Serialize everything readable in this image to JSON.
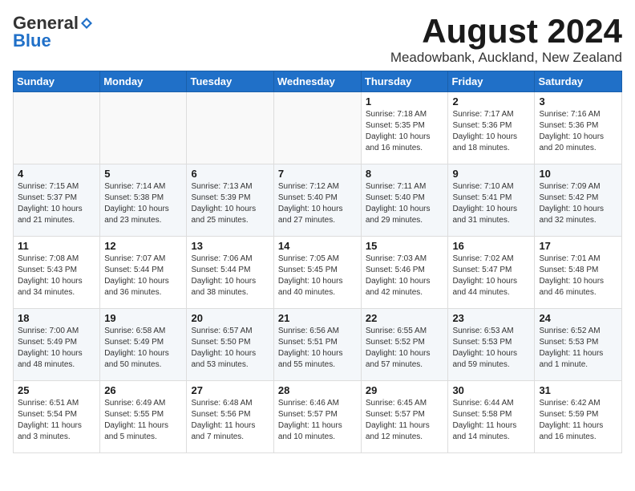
{
  "header": {
    "logo_general": "General",
    "logo_blue": "Blue",
    "month_title": "August 2024",
    "location": "Meadowbank, Auckland, New Zealand"
  },
  "weekdays": [
    "Sunday",
    "Monday",
    "Tuesday",
    "Wednesday",
    "Thursday",
    "Friday",
    "Saturday"
  ],
  "weeks": [
    [
      {
        "day": "",
        "info": ""
      },
      {
        "day": "",
        "info": ""
      },
      {
        "day": "",
        "info": ""
      },
      {
        "day": "",
        "info": ""
      },
      {
        "day": "1",
        "info": "Sunrise: 7:18 AM\nSunset: 5:35 PM\nDaylight: 10 hours\nand 16 minutes."
      },
      {
        "day": "2",
        "info": "Sunrise: 7:17 AM\nSunset: 5:36 PM\nDaylight: 10 hours\nand 18 minutes."
      },
      {
        "day": "3",
        "info": "Sunrise: 7:16 AM\nSunset: 5:36 PM\nDaylight: 10 hours\nand 20 minutes."
      }
    ],
    [
      {
        "day": "4",
        "info": "Sunrise: 7:15 AM\nSunset: 5:37 PM\nDaylight: 10 hours\nand 21 minutes."
      },
      {
        "day": "5",
        "info": "Sunrise: 7:14 AM\nSunset: 5:38 PM\nDaylight: 10 hours\nand 23 minutes."
      },
      {
        "day": "6",
        "info": "Sunrise: 7:13 AM\nSunset: 5:39 PM\nDaylight: 10 hours\nand 25 minutes."
      },
      {
        "day": "7",
        "info": "Sunrise: 7:12 AM\nSunset: 5:40 PM\nDaylight: 10 hours\nand 27 minutes."
      },
      {
        "day": "8",
        "info": "Sunrise: 7:11 AM\nSunset: 5:40 PM\nDaylight: 10 hours\nand 29 minutes."
      },
      {
        "day": "9",
        "info": "Sunrise: 7:10 AM\nSunset: 5:41 PM\nDaylight: 10 hours\nand 31 minutes."
      },
      {
        "day": "10",
        "info": "Sunrise: 7:09 AM\nSunset: 5:42 PM\nDaylight: 10 hours\nand 32 minutes."
      }
    ],
    [
      {
        "day": "11",
        "info": "Sunrise: 7:08 AM\nSunset: 5:43 PM\nDaylight: 10 hours\nand 34 minutes."
      },
      {
        "day": "12",
        "info": "Sunrise: 7:07 AM\nSunset: 5:44 PM\nDaylight: 10 hours\nand 36 minutes."
      },
      {
        "day": "13",
        "info": "Sunrise: 7:06 AM\nSunset: 5:44 PM\nDaylight: 10 hours\nand 38 minutes."
      },
      {
        "day": "14",
        "info": "Sunrise: 7:05 AM\nSunset: 5:45 PM\nDaylight: 10 hours\nand 40 minutes."
      },
      {
        "day": "15",
        "info": "Sunrise: 7:03 AM\nSunset: 5:46 PM\nDaylight: 10 hours\nand 42 minutes."
      },
      {
        "day": "16",
        "info": "Sunrise: 7:02 AM\nSunset: 5:47 PM\nDaylight: 10 hours\nand 44 minutes."
      },
      {
        "day": "17",
        "info": "Sunrise: 7:01 AM\nSunset: 5:48 PM\nDaylight: 10 hours\nand 46 minutes."
      }
    ],
    [
      {
        "day": "18",
        "info": "Sunrise: 7:00 AM\nSunset: 5:49 PM\nDaylight: 10 hours\nand 48 minutes."
      },
      {
        "day": "19",
        "info": "Sunrise: 6:58 AM\nSunset: 5:49 PM\nDaylight: 10 hours\nand 50 minutes."
      },
      {
        "day": "20",
        "info": "Sunrise: 6:57 AM\nSunset: 5:50 PM\nDaylight: 10 hours\nand 53 minutes."
      },
      {
        "day": "21",
        "info": "Sunrise: 6:56 AM\nSunset: 5:51 PM\nDaylight: 10 hours\nand 55 minutes."
      },
      {
        "day": "22",
        "info": "Sunrise: 6:55 AM\nSunset: 5:52 PM\nDaylight: 10 hours\nand 57 minutes."
      },
      {
        "day": "23",
        "info": "Sunrise: 6:53 AM\nSunset: 5:53 PM\nDaylight: 10 hours\nand 59 minutes."
      },
      {
        "day": "24",
        "info": "Sunrise: 6:52 AM\nSunset: 5:53 PM\nDaylight: 11 hours\nand 1 minute."
      }
    ],
    [
      {
        "day": "25",
        "info": "Sunrise: 6:51 AM\nSunset: 5:54 PM\nDaylight: 11 hours\nand 3 minutes."
      },
      {
        "day": "26",
        "info": "Sunrise: 6:49 AM\nSunset: 5:55 PM\nDaylight: 11 hours\nand 5 minutes."
      },
      {
        "day": "27",
        "info": "Sunrise: 6:48 AM\nSunset: 5:56 PM\nDaylight: 11 hours\nand 7 minutes."
      },
      {
        "day": "28",
        "info": "Sunrise: 6:46 AM\nSunset: 5:57 PM\nDaylight: 11 hours\nand 10 minutes."
      },
      {
        "day": "29",
        "info": "Sunrise: 6:45 AM\nSunset: 5:57 PM\nDaylight: 11 hours\nand 12 minutes."
      },
      {
        "day": "30",
        "info": "Sunrise: 6:44 AM\nSunset: 5:58 PM\nDaylight: 11 hours\nand 14 minutes."
      },
      {
        "day": "31",
        "info": "Sunrise: 6:42 AM\nSunset: 5:59 PM\nDaylight: 11 hours\nand 16 minutes."
      }
    ]
  ]
}
